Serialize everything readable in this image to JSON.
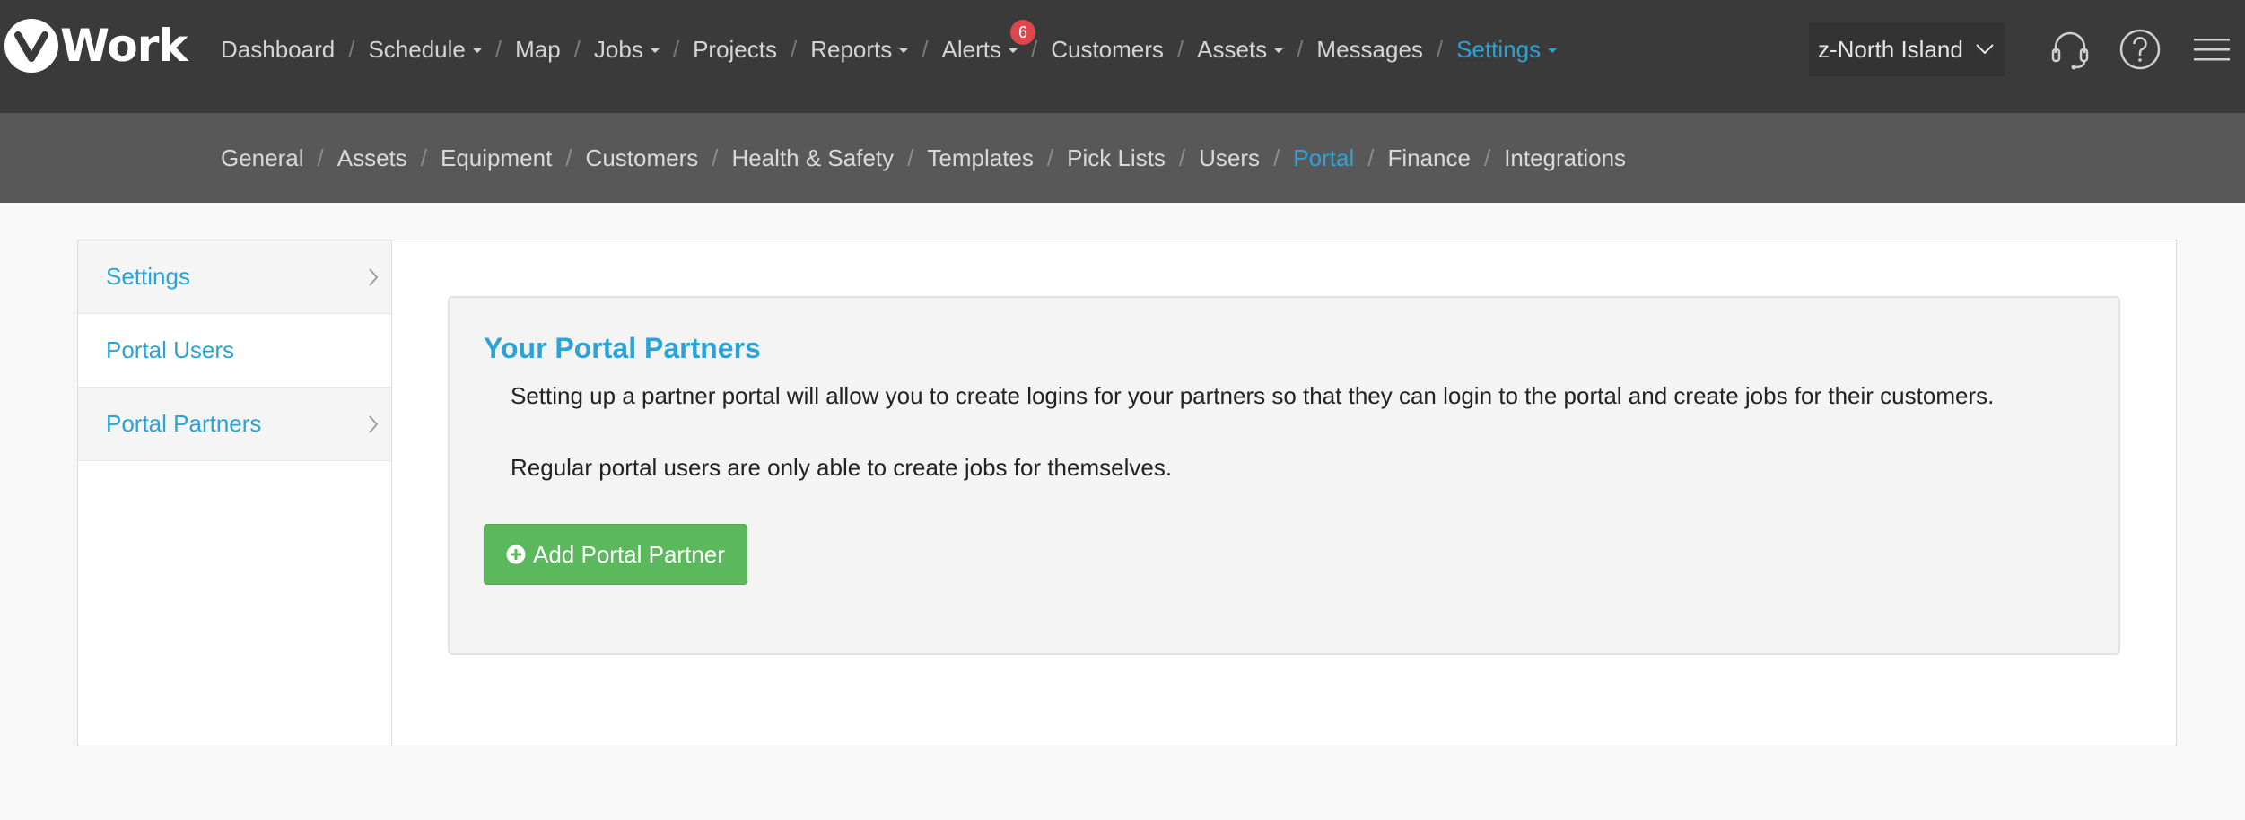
{
  "app": {
    "logo_text": "Work",
    "logo_letter": "v",
    "accent_color": "#2aa3d8",
    "success_color": "#5cb85c"
  },
  "main_nav": {
    "items": [
      {
        "label": "Dashboard"
      },
      {
        "label": "Schedule",
        "dropdown": true
      },
      {
        "label": "Map"
      },
      {
        "label": "Jobs",
        "dropdown": true
      },
      {
        "label": "Projects"
      },
      {
        "label": "Reports",
        "dropdown": true
      },
      {
        "label": "Alerts",
        "dropdown": true,
        "badge": "6"
      },
      {
        "label": "Customers"
      },
      {
        "label": "Assets",
        "dropdown": true
      },
      {
        "label": "Messages"
      },
      {
        "label": "Settings",
        "dropdown": true,
        "active": true
      }
    ],
    "separator": "/"
  },
  "region_select": {
    "value": "z-North Island"
  },
  "header_icons": [
    "headset-icon",
    "help-icon",
    "hamburger-menu-icon"
  ],
  "sub_nav": {
    "items": [
      {
        "label": "General"
      },
      {
        "label": "Assets"
      },
      {
        "label": "Equipment"
      },
      {
        "label": "Customers"
      },
      {
        "label": "Health & Safety"
      },
      {
        "label": "Templates"
      },
      {
        "label": "Pick Lists"
      },
      {
        "label": "Users"
      },
      {
        "label": "Portal",
        "active": true
      },
      {
        "label": "Finance"
      },
      {
        "label": "Integrations"
      }
    ]
  },
  "sidebar": {
    "items": [
      {
        "label": "Settings",
        "chevron": true
      },
      {
        "label": "Portal Users",
        "chevron": false,
        "selected": true
      },
      {
        "label": "Portal Partners",
        "chevron": true
      }
    ]
  },
  "main": {
    "title": "Your Portal Partners",
    "description_1": "Setting up a partner portal will allow you to create logins for your partners so that they can login to the portal and create jobs for their customers.",
    "description_2": "Regular portal users are only able to create jobs for themselves.",
    "add_button_label": "Add Portal Partner"
  }
}
